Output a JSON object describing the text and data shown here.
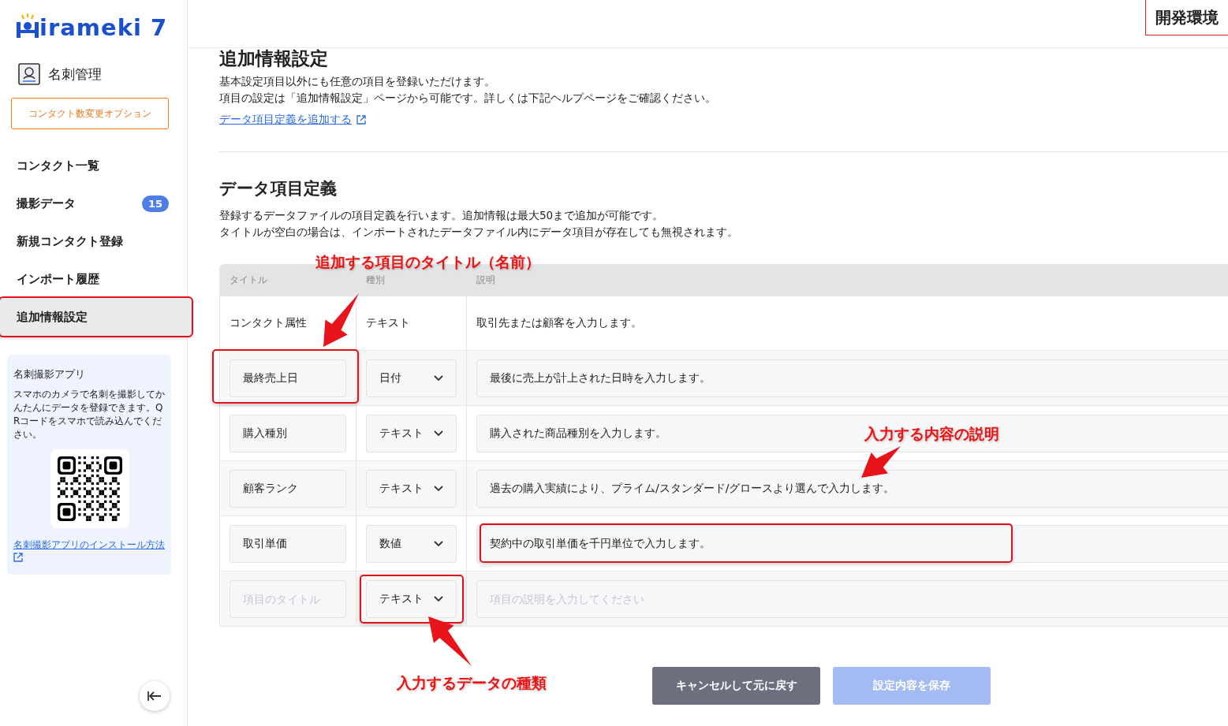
{
  "header": {
    "environment_badge": "開発環境"
  },
  "sidebar": {
    "logo": "irameki 7",
    "module": "名刺管理",
    "option_button": "コンタクト数変更オプション",
    "nav": [
      {
        "label": "コンタクト一覧",
        "selected": false,
        "highlighted": false
      },
      {
        "label": "撮影データ",
        "selected": false,
        "highlighted": false,
        "badge": "15"
      },
      {
        "label": "新規コンタクト登録",
        "selected": false,
        "highlighted": false
      },
      {
        "label": "インポート履歴",
        "selected": false,
        "highlighted": false
      },
      {
        "label": "追加情報設定",
        "selected": true,
        "highlighted": true
      }
    ],
    "app_card": {
      "title": "名刺撮影アプリ",
      "text": "スマホのカメラで名刺を撮影してかんたんにデータを登録できます。QRコードをスマホで読み込んでください。",
      "link": "名刺撮影アプリのインストール方法"
    }
  },
  "page": {
    "title": "追加情報設定",
    "intro": [
      "基本設定項目以外にも任意の項目を登録いただけます。",
      "項目の設定は「追加情報設定」ページから可能です。詳しくは下記ヘルプページをご確認ください。"
    ],
    "link": "データ項目定義を追加する"
  },
  "definitions": {
    "title": "データ項目定義",
    "description": [
      "登録するデータファイルの項目定義を行います。追加情報は最大50まで追加が可能です。",
      "タイトルが空白の場合は、インポートされたデータファイル内にデータ項目が存在しても無視されます。"
    ],
    "columns": [
      "タイトル",
      "種別",
      "説明"
    ],
    "rows": [
      {
        "kind": "fixed",
        "title": "コンタクト属性",
        "type": "テキスト",
        "description": "取引先または顧客を入力します。"
      },
      {
        "kind": "editable",
        "title": "最終売上日",
        "type": "日付",
        "description": "最後に売上が計上された日時を入力します。",
        "title_highlighted": true,
        "type_highlighted": false,
        "description_highlighted": false
      },
      {
        "kind": "editable",
        "title": "購入種別",
        "type": "テキスト",
        "description": "購入された商品種別を入力します。",
        "title_highlighted": false,
        "type_highlighted": false,
        "description_highlighted": false
      },
      {
        "kind": "editable",
        "title": "顧客ランク",
        "type": "テキスト",
        "description": "過去の購入実績により、プライム/スタンダード/グロースより選んで入力します。",
        "title_highlighted": false,
        "type_highlighted": false,
        "description_highlighted": false
      },
      {
        "kind": "editable",
        "title": "取引単価",
        "type": "数値",
        "description": "契約中の取引単価を千円単位で入力します。",
        "title_highlighted": false,
        "type_highlighted": false,
        "description_highlighted": true
      },
      {
        "kind": "new",
        "title_placeholder": "項目のタイトル",
        "type": "テキスト",
        "description_placeholder": "項目の説明を入力してください",
        "title_highlighted": false,
        "type_highlighted": true,
        "description_highlighted": false
      }
    ]
  },
  "buttons": [
    {
      "label": "キャンセルして元に戻す",
      "kind": "secondary",
      "disabled": false
    },
    {
      "label": "設定内容を保存",
      "kind": "primary",
      "disabled": true
    }
  ],
  "annotations": [
    {
      "text": "追加する項目のタイトル（名前）"
    },
    {
      "text": "入力する内容の説明"
    },
    {
      "text": "入力するデータの種類"
    }
  ]
}
